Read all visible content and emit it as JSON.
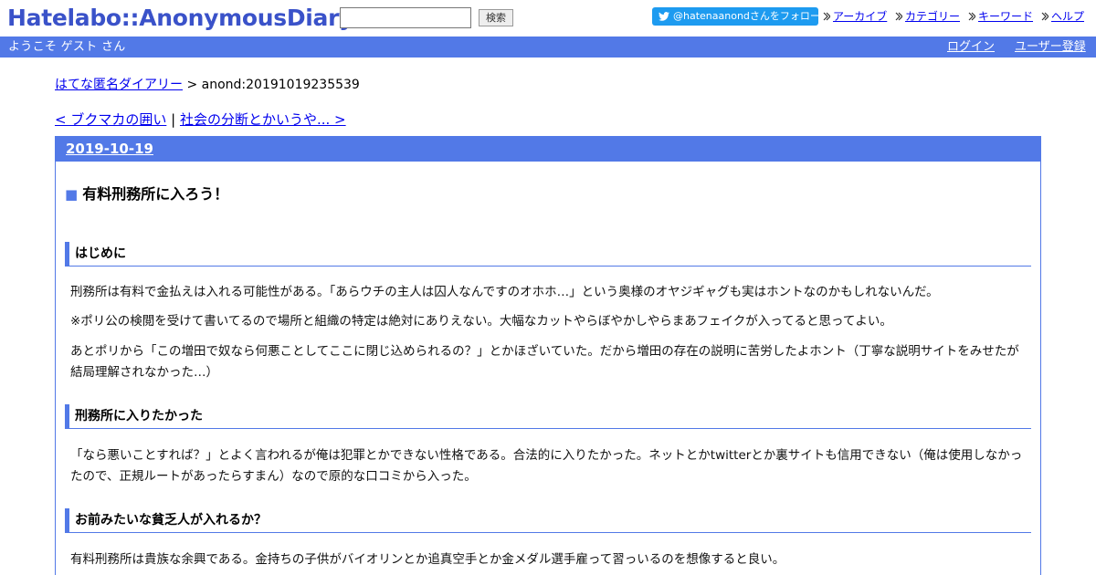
{
  "header": {
    "logo": "Hatelabo::AnonymousDiary",
    "search_placeholder": "",
    "search_button": "検索",
    "follow_button": "@hatenaanondさんをフォロー",
    "nav": [
      "アーカイブ",
      "カテゴリー",
      "キーワード",
      "ヘルプ"
    ]
  },
  "bar": {
    "welcome": "ようこそ ゲスト さん",
    "login": "ログイン",
    "register": "ユーザー登録"
  },
  "breadcrumb": {
    "home": "はてな匿名ダイアリー",
    "separator": ">",
    "current": "anond:20191019235539"
  },
  "pager": {
    "prev": "< ブクマカの囲い",
    "separator": "|",
    "next": "社会の分断とかいうや... >"
  },
  "entry": {
    "date": "2019-10-19",
    "title_marker": "■",
    "title": "有料刑務所に入ろう！",
    "sections": [
      {
        "heading": "はじめに",
        "paragraphs": [
          "刑務所は有料で金払えは入れる可能性がある。「あらウチの主人は囚人なんですのオホホ…」という奥様のオヤジギャグも実はホントなのかもしれないんだ。",
          "※ポリ公の検閲を受けて書いてるので場所と組織の特定は絶対にありえない。大幅なカットやらぼやかしやらまあフェイクが入ってると思ってよい。",
          "あとポリから「この増田で奴なら何悪ことしてここに閉じ込められるの？」とかほざいていた。だから増田の存在の説明に苦労したよホント（丁寧な説明サイトをみせたが結局理解されなかった…）"
        ]
      },
      {
        "heading": "刑務所に入りたかった",
        "paragraphs": [
          "「なら悪いことすれば？」とよく言われるが俺は犯罪とかできない性格である。合法的に入りたかった。ネットとかtwitterとか裏サイトも信用できない（俺は使用しなかったので、正規ルートがあったらすまん）なので原的な口コミから入った。"
        ]
      },
      {
        "heading": "お前みたいな貧乏人が入れるか？",
        "paragraphs": [
          "有料刑務所は貴族な余興である。金持ちの子供がバイオリンとか追真空手とか金メダル選手雇って習っいるのを想像すると良い。"
        ]
      }
    ]
  },
  "colors": {
    "accent": "#5279e7",
    "logo": "#3a52c9",
    "twitter": "#1d9bf0",
    "link": "#0000ee"
  }
}
